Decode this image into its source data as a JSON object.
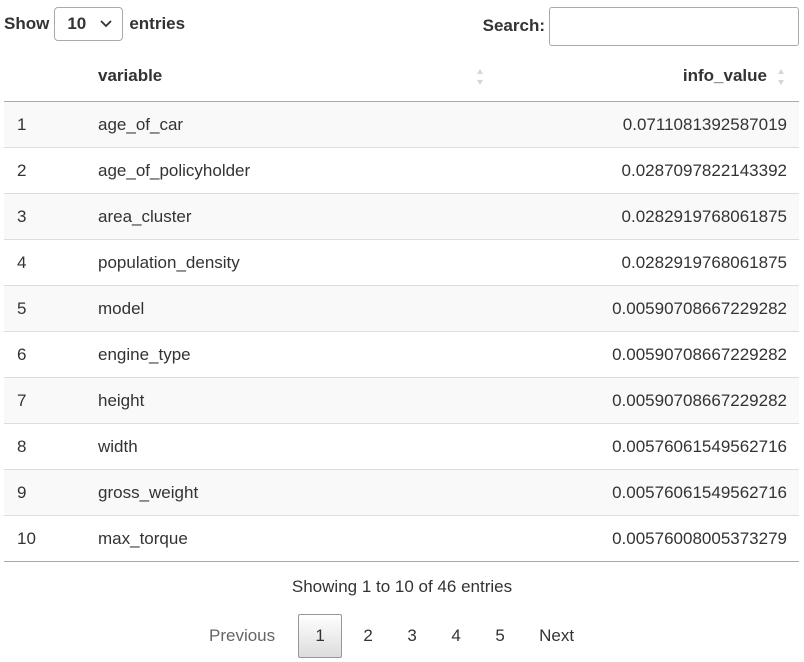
{
  "length": {
    "show_label": "Show",
    "value": "10",
    "entries_label": "entries"
  },
  "search": {
    "label": "Search:",
    "value": "",
    "placeholder": ""
  },
  "table": {
    "columns": [
      "",
      "variable",
      "info_value"
    ],
    "rows": [
      {
        "idx": "1",
        "variable": "age_of_car",
        "info_value": "0.0711081392587019"
      },
      {
        "idx": "2",
        "variable": "age_of_policyholder",
        "info_value": "0.0287097822143392"
      },
      {
        "idx": "3",
        "variable": "area_cluster",
        "info_value": "0.0282919768061875"
      },
      {
        "idx": "4",
        "variable": "population_density",
        "info_value": "0.0282919768061875"
      },
      {
        "idx": "5",
        "variable": "model",
        "info_value": "0.00590708667229282"
      },
      {
        "idx": "6",
        "variable": "engine_type",
        "info_value": "0.00590708667229282"
      },
      {
        "idx": "7",
        "variable": "height",
        "info_value": "0.00590708667229282"
      },
      {
        "idx": "8",
        "variable": "width",
        "info_value": "0.00576061549562716"
      },
      {
        "idx": "9",
        "variable": "gross_weight",
        "info_value": "0.00576061549562716"
      },
      {
        "idx": "10",
        "variable": "max_torque",
        "info_value": "0.00576008005373279"
      }
    ]
  },
  "info": "Showing 1 to 10 of 46 entries",
  "pagination": {
    "previous": "Previous",
    "pages": [
      "1",
      "2",
      "3",
      "4",
      "5"
    ],
    "current": "1",
    "next": "Next"
  }
}
